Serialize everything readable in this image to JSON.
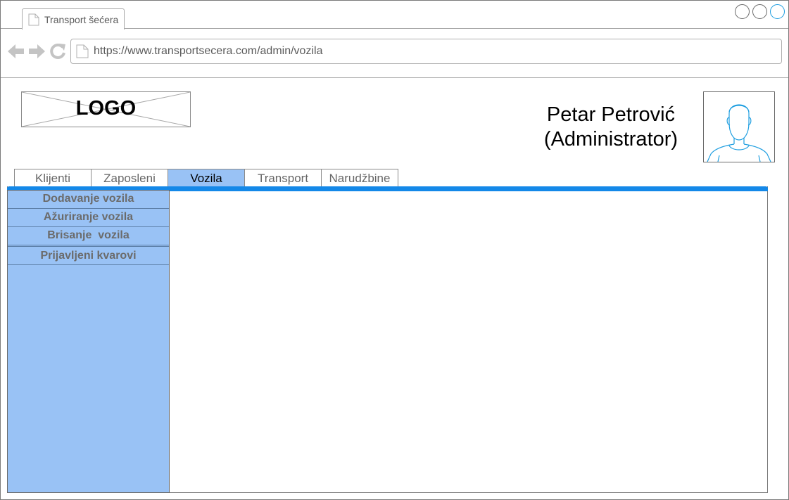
{
  "browser": {
    "tab_title": "Transport šećera",
    "url": "https://www.transportsecera.com/admin/vozila"
  },
  "header": {
    "logo_text": "LOGO",
    "user_name": "Petar Petrović",
    "user_role": "(Administrator)"
  },
  "tabs": [
    {
      "label": "Klijenti",
      "active": false
    },
    {
      "label": "Zaposleni",
      "active": false
    },
    {
      "label": "Vozila",
      "active": true
    },
    {
      "label": "Transport",
      "active": false
    },
    {
      "label": "Narudžbine",
      "active": false
    }
  ],
  "sidebar": {
    "items": [
      {
        "label": "Dodavanje vozila"
      },
      {
        "label": "Ažuriranje vozila"
      },
      {
        "label": "Brisanje  vozila"
      },
      {
        "label": "Prijavljeni kvarovi"
      }
    ]
  },
  "colors": {
    "accent": "#1488e8",
    "active_tab": "#99c2f5",
    "sidebar": "#99c2f5",
    "window_active": "#1e9ee0"
  },
  "icons": {
    "back": "back-arrow-icon",
    "forward": "forward-arrow-icon",
    "reload": "reload-icon",
    "page": "page-icon",
    "avatar": "user-avatar-icon"
  }
}
